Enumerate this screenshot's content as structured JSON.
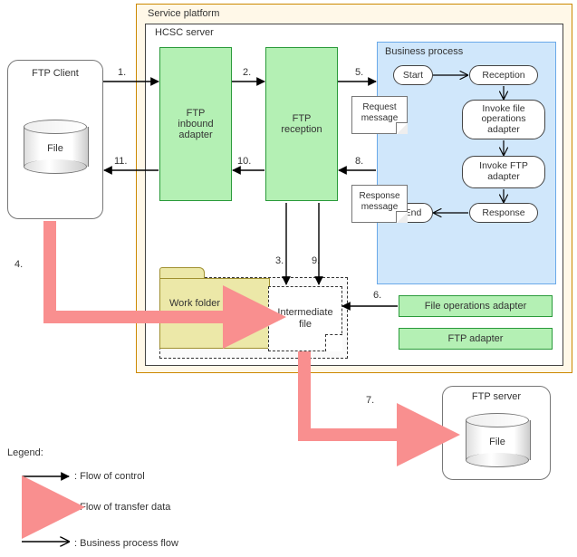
{
  "frames": {
    "service_platform": "Service platform",
    "hcsc_server": "HCSC server"
  },
  "ftp_client": {
    "title": "FTP Client",
    "file_label": "File"
  },
  "nodes": {
    "ftp_inbound": "FTP\ninbound\nadapter",
    "ftp_reception": "FTP\nreception",
    "file_ops_adapter": "File operations adapter",
    "ftp_adapter": "FTP adapter"
  },
  "business_process": {
    "title": "Business process",
    "start": "Start",
    "reception": "Reception",
    "invoke_file": "Invoke file\noperations\nadapter",
    "invoke_ftp": "Invoke FTP\nadapter",
    "response": "Response",
    "end": "End"
  },
  "work_folder": {
    "label": "Work folder",
    "intermediate": "Intermediate\nfile"
  },
  "messages": {
    "request": "Request\nmessage",
    "response": "Response\nmessage"
  },
  "steps": {
    "s1": "1.",
    "s2": "2.",
    "s3": "3.",
    "s4": "4.",
    "s5": "5.",
    "s6": "6.",
    "s7": "7.",
    "s8": "8.",
    "s9": "9.",
    "s10": "10.",
    "s11": "11."
  },
  "ftp_server": {
    "title": "FTP server",
    "file_label": "File"
  },
  "legend": {
    "heading": "Legend:",
    "control": ": Flow of control",
    "transfer": ": Flow of transfer data",
    "bp": ": Business process flow"
  }
}
